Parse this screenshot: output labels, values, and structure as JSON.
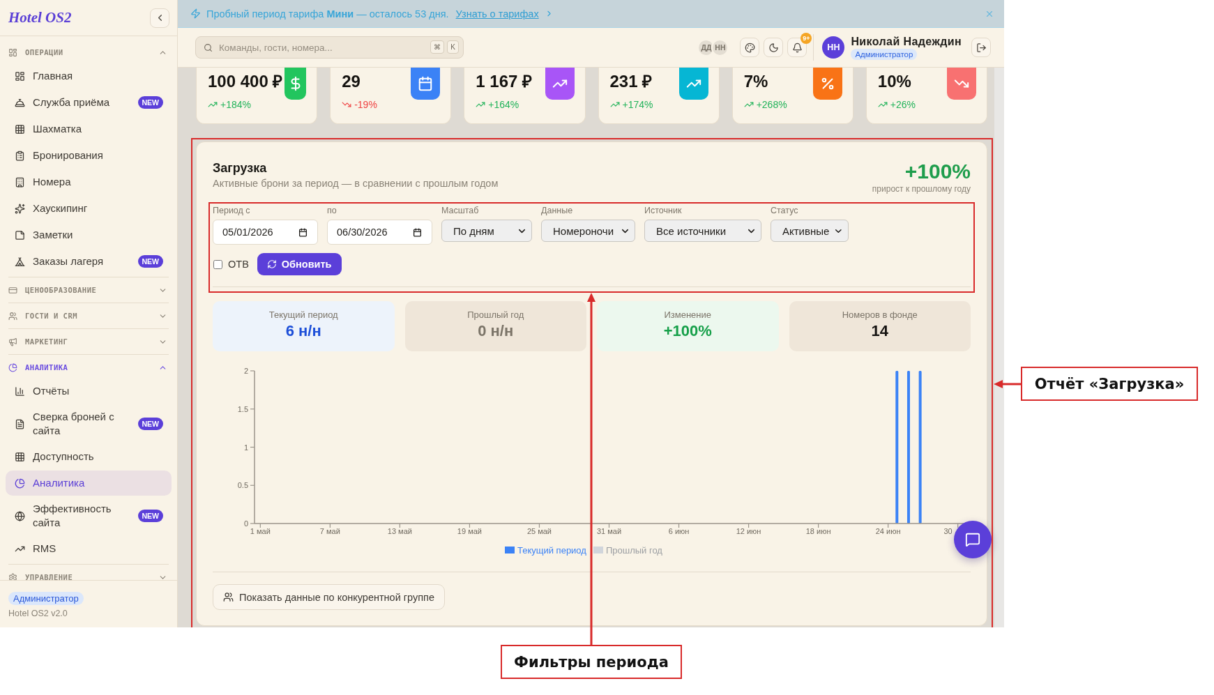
{
  "sidebar": {
    "logo": "Hotel OS2",
    "sections": [
      {
        "title": "ОПЕРАЦИИ",
        "expanded": true,
        "items": [
          {
            "label": "Главная",
            "selected": false
          },
          {
            "label": "Служба приёма",
            "selected": false,
            "badge": "NEW"
          },
          {
            "label": "Шахматка",
            "selected": false
          },
          {
            "label": "Бронирования",
            "selected": false
          },
          {
            "label": "Номера",
            "selected": false
          },
          {
            "label": "Хаускипинг",
            "selected": false
          },
          {
            "label": "Заметки",
            "selected": false
          },
          {
            "label": "Заказы лагеря",
            "selected": false,
            "badge": "NEW"
          }
        ]
      },
      {
        "title": "ЦЕНООБРАЗОВАНИЕ",
        "expanded": false
      },
      {
        "title": "ГОСТИ И CRM",
        "expanded": false
      },
      {
        "title": "МАРКЕТИНГ",
        "expanded": false
      },
      {
        "title": "АНАЛИТИКА",
        "expanded": true,
        "items": [
          {
            "label": "Отчёты",
            "selected": false
          },
          {
            "label": "Сверка броней с сайта",
            "selected": false,
            "badge": "NEW"
          },
          {
            "label": "Доступность",
            "selected": false
          },
          {
            "label": "Аналитика",
            "selected": true
          },
          {
            "label": "Эффективность сайта",
            "selected": false,
            "badge": "NEW"
          },
          {
            "label": "RMS",
            "selected": false
          }
        ]
      },
      {
        "title": "УПРАВЛЕНИЕ",
        "expanded": false
      }
    ],
    "footer": {
      "role": "Администратор",
      "version": "Hotel OS2 v2.0"
    }
  },
  "banner": {
    "text": "Пробный период тарифа **Мини** — осталось 53 дня.",
    "link": "Узнать о тарифах"
  },
  "topbar": {
    "search": {
      "placeholder": "Команды, гости, номера...",
      "keys": [
        "⌘",
        "K"
      ]
    },
    "presence": [
      "ДД",
      "НН"
    ],
    "notifications": "9+",
    "user": {
      "initials": "НН",
      "name": "Николай Надеждин",
      "role": "Администратор"
    }
  },
  "kpis": [
    {
      "value": "100 400 ₽",
      "change": "+184%",
      "up": true,
      "color": "#22c55e"
    },
    {
      "value": "29",
      "change": "-19%",
      "up": false,
      "color": "#3b82f6"
    },
    {
      "value": "1 167 ₽",
      "change": "+164%",
      "up": true,
      "color": "#a855f7"
    },
    {
      "value": "231 ₽",
      "change": "+174%",
      "up": true,
      "color": "#06b6d4"
    },
    {
      "value": "7%",
      "change": "+268%",
      "up": true,
      "color": "#f97316"
    },
    {
      "value": "10%",
      "change": "+26%",
      "up": true,
      "color": "#f87171"
    }
  ],
  "report": {
    "title": "Загрузка",
    "subtitle": "Активные брони за период — в сравнении с прошлым годом",
    "growth": {
      "value": "+100%",
      "caption": "прирост к прошлому году"
    },
    "filters": [
      {
        "kind": "date",
        "label": "Период с",
        "value": "05/01/2026"
      },
      {
        "kind": "date",
        "label": "по",
        "value": "06/30/2026"
      },
      {
        "kind": "select",
        "label": "Масштаб",
        "value": "По дням"
      },
      {
        "kind": "select",
        "label": "Данные",
        "value": "Номероночи"
      },
      {
        "kind": "select",
        "label": "Источник",
        "value": "Все источники"
      },
      {
        "kind": "select",
        "label": "Статус",
        "value": "Активные"
      }
    ],
    "otb": {
      "label": "ОТВ",
      "checked": false
    },
    "refresh_button": "Обновить",
    "stats": [
      {
        "kind": "current",
        "label": "Текущий период",
        "value": "6 н/н"
      },
      {
        "kind": "previous",
        "label": "Прошлый год",
        "value": "0 н/н"
      },
      {
        "kind": "change",
        "label": "Изменение",
        "value": "+100%"
      },
      {
        "kind": "total",
        "label": "Номеров в фонде",
        "value": "14"
      }
    ],
    "chart_data": {
      "type": "bar",
      "categories": [
        "1 май",
        null,
        null,
        null,
        null,
        null,
        "7 май",
        null,
        null,
        null,
        null,
        null,
        "13 май",
        null,
        null,
        null,
        null,
        null,
        "19 май",
        null,
        null,
        null,
        null,
        null,
        "25 май",
        null,
        null,
        null,
        null,
        null,
        "31 май",
        null,
        null,
        null,
        null,
        null,
        "6 июн",
        null,
        null,
        null,
        null,
        null,
        "12 июн",
        null,
        null,
        null,
        null,
        null,
        "18 июн",
        null,
        null,
        null,
        null,
        null,
        "24 июн",
        null,
        null,
        null,
        null,
        null,
        "30"
      ],
      "series": [
        {
          "name": "Текущий период",
          "color": "#3b82f6",
          "values": [
            0,
            0,
            0,
            0,
            0,
            0,
            0,
            0,
            0,
            0,
            0,
            0,
            0,
            0,
            0,
            0,
            0,
            0,
            0,
            0,
            0,
            0,
            0,
            0,
            0,
            0,
            0,
            0,
            0,
            0,
            0,
            0,
            0,
            0,
            0,
            0,
            0,
            0,
            0,
            0,
            0,
            0,
            0,
            0,
            0,
            0,
            0,
            0,
            0,
            0,
            0,
            0,
            0,
            0,
            0,
            2,
            2,
            2,
            0,
            0,
            0
          ]
        },
        {
          "name": "Прошлый год",
          "color": "#d1d5db",
          "values": [
            0,
            0,
            0,
            0,
            0,
            0,
            0,
            0,
            0,
            0,
            0,
            0,
            0,
            0,
            0,
            0,
            0,
            0,
            0,
            0,
            0,
            0,
            0,
            0,
            0,
            0,
            0,
            0,
            0,
            0,
            0,
            0,
            0,
            0,
            0,
            0,
            0,
            0,
            0,
            0,
            0,
            0,
            0,
            0,
            0,
            0,
            0,
            0,
            0,
            0,
            0,
            0,
            0,
            0,
            0,
            0,
            0,
            0,
            0,
            0,
            0
          ]
        }
      ],
      "ylim": [
        0,
        2
      ],
      "yticks": [
        0,
        0.5,
        1,
        1.5,
        2
      ]
    },
    "peer_button": "Показать данные по конкурентной группе"
  },
  "annotations": [
    {
      "label": "Отчёт «Загрузка»"
    },
    {
      "label": "Фильтры периода"
    }
  ]
}
